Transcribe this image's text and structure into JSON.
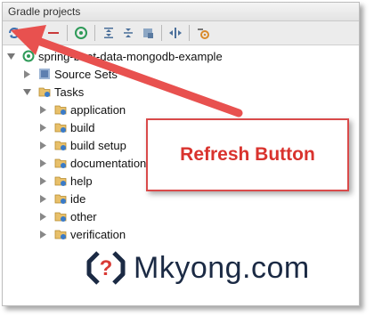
{
  "window": {
    "title": "Gradle projects"
  },
  "toolbar": {
    "buttons": [
      "refresh-icon",
      "add-icon",
      "remove-icon",
      "execute-task-icon",
      "expand-all-icon",
      "collapse-all-icon",
      "offline-icon",
      "toggle-icon",
      "settings-icon"
    ]
  },
  "tree": {
    "project": "spring-boot-data-mongodb-example",
    "source_sets": "Source Sets",
    "tasks": "Tasks",
    "task_groups": [
      "application",
      "build",
      "build setup",
      "documentation",
      "help",
      "ide",
      "other",
      "verification"
    ]
  },
  "callout": {
    "text": "Refresh Button"
  },
  "brand": {
    "name": "Mkyong.com"
  },
  "colors": {
    "arrow": "#e8514f",
    "callout_border": "#d94a4a",
    "callout_text": "#d9332e"
  }
}
